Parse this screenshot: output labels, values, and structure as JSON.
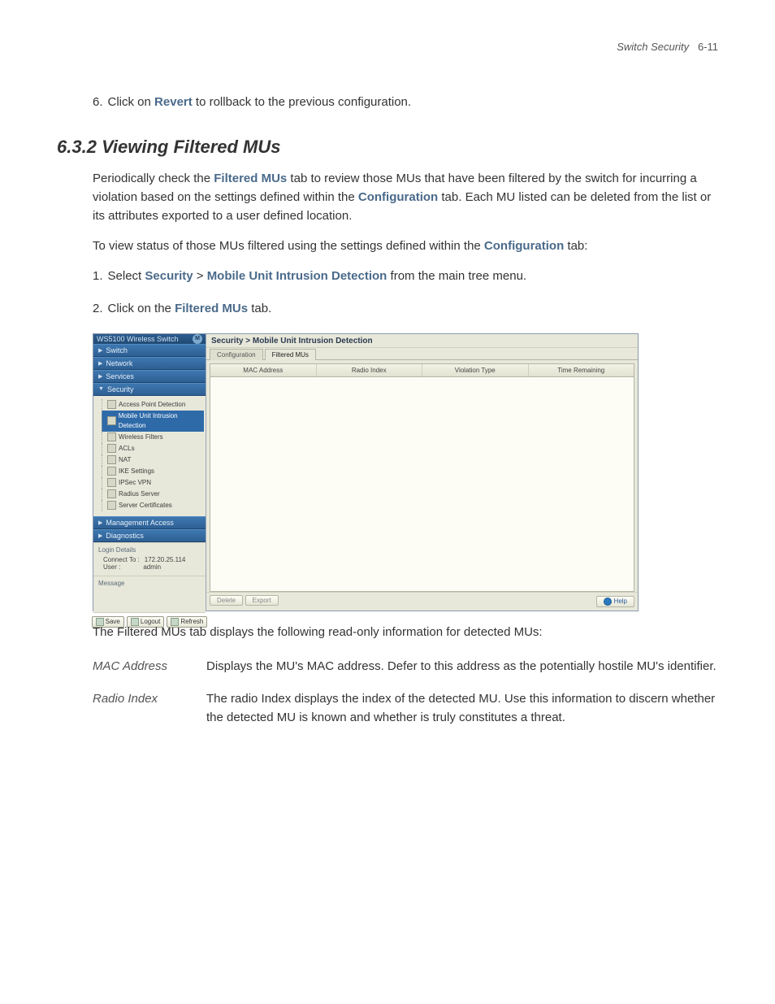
{
  "header": {
    "title": "Switch Security",
    "pagenum": "6-11"
  },
  "step6": {
    "num": "6.",
    "t1": "Click on ",
    "revert": "Revert",
    "t2": " to rollback to the previous configuration."
  },
  "section": {
    "num": "6.3.2",
    "title": "Viewing Filtered MUs"
  },
  "p1": {
    "t1": "Periodically check the ",
    "filtered": "Filtered MUs",
    "t2": " tab to review those MUs that have been filtered by the switch for incurring a violation based on the settings defined within the ",
    "config": "Configuration",
    "t3": " tab. Each MU listed can be deleted from the list or its attributes exported to a user defined location."
  },
  "p2": {
    "t1": "To view status of those MUs filtered using the settings defined within the ",
    "config": "Configuration",
    "t2": " tab:"
  },
  "s1": {
    "num": "1.",
    "t1": "Select ",
    "security": "Security",
    "gt": " > ",
    "muid": "Mobile Unit Intrusion Detection",
    "t2": " from the main tree menu."
  },
  "s2": {
    "num": "2.",
    "t1": "Click on the ",
    "filtered": "Filtered MUs",
    "t2": " tab."
  },
  "app": {
    "brand": "WS5100 Wireless Switch",
    "nav": {
      "switch": "Switch",
      "network": "Network",
      "services": "Services",
      "security": "Security",
      "mgmt": "Management Access",
      "diag": "Diagnostics"
    },
    "tree": {
      "apd": "Access Point Detection",
      "muid": "Mobile Unit Intrusion Detection",
      "wf": "Wireless Filters",
      "acls": "ACLs",
      "nat": "NAT",
      "ike": "IKE Settings",
      "ipsec": "IPSec VPN",
      "radius": "Radius Server",
      "certs": "Server Certificates"
    },
    "login": {
      "title": "Login Details",
      "connect_l": "Connect To :",
      "connect_v": "172.20.25.114",
      "user_l": "User :",
      "user_v": "admin"
    },
    "msg": {
      "title": "Message"
    },
    "buttons": {
      "save": "Save",
      "logout": "Logout",
      "refresh": "Refresh"
    },
    "breadcrumb": "Security > Mobile Unit Intrusion Detection",
    "tabs": {
      "config": "Configuration",
      "filtered": "Filtered MUs"
    },
    "cols": {
      "mac": "MAC Address",
      "radio": "Radio Index",
      "viol": "Violation Type",
      "time": "Time Remaining"
    },
    "footer": {
      "delete": "Delete",
      "export": "Export",
      "help": "Help"
    }
  },
  "caption": "The Filtered MUs tab displays the following read-only information for detected MUs:",
  "defs": {
    "mac_t": "MAC Address",
    "mac_d": "Displays the MU's MAC address. Defer to this address as the potentially hostile MU's identifier.",
    "ri_t": "Radio Index",
    "ri_d": "The radio Index displays the index of the detected MU. Use this information to discern whether the detected MU is known and whether is truly constitutes a threat."
  }
}
